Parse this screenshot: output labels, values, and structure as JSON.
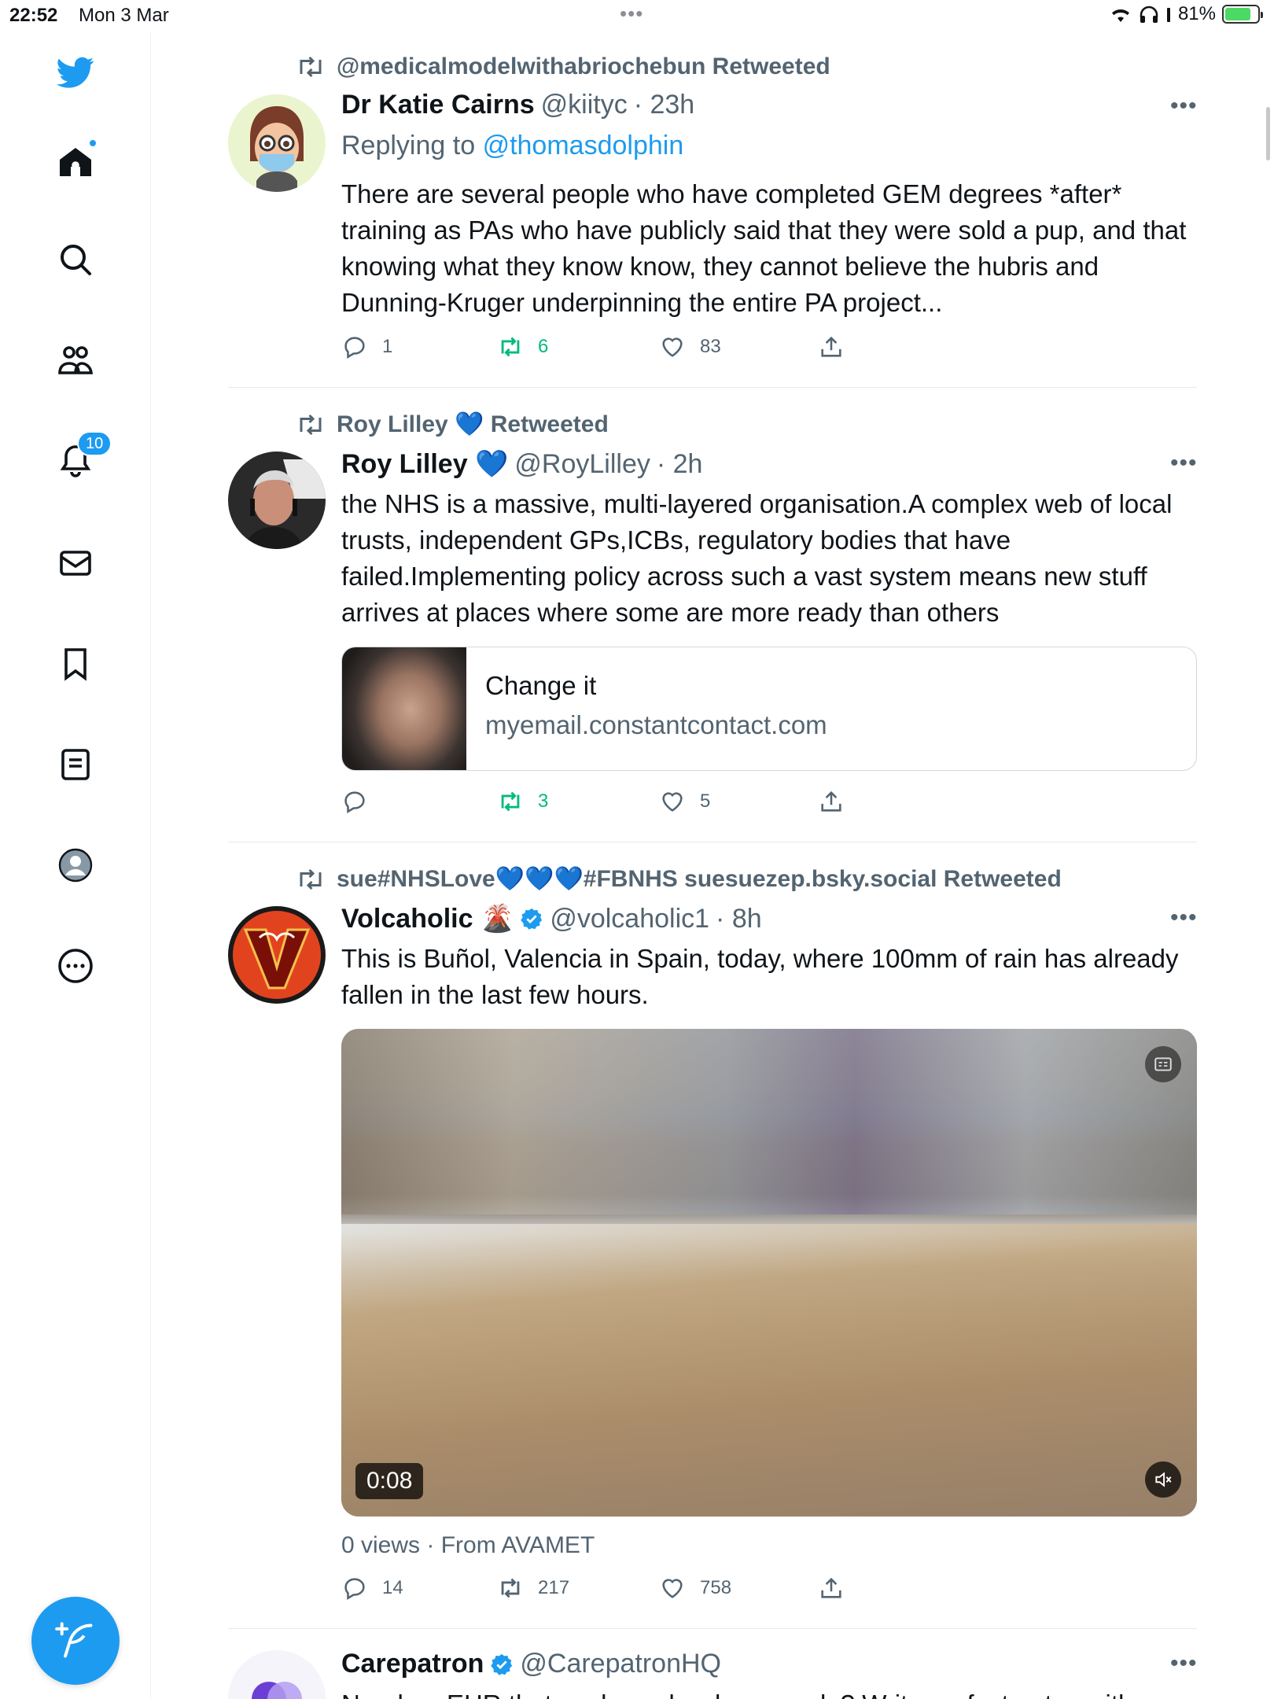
{
  "status_bar": {
    "time": "22:52",
    "date": "Mon 3 Mar",
    "battery": "81%",
    "battery_level": 0.81
  },
  "sidebar": {
    "notifications_badge": "10",
    "items": [
      "twitter-logo",
      "home-icon",
      "search-icon",
      "communities-icon",
      "notifications-icon",
      "messages-icon",
      "bookmarks-icon",
      "lists-icon",
      "profile-icon",
      "more-icon"
    ]
  },
  "tweets": [
    {
      "retweeted_by": "@medicalmodelwithabriochebun Retweeted",
      "name": "Dr Katie Cairns",
      "handle": "@kiityc",
      "time": "· 23h",
      "replying_label": "Replying to",
      "replying_to": "@thomasdolphin",
      "text": "There are several people who have completed GEM degrees *after* training as PAs who have publicly said that they were sold a pup, and that knowing what they know know, they cannot believe the hubris and Dunning-Kruger underpinning the entire PA project...",
      "replies": "1",
      "retweets": "6",
      "likes": "83"
    },
    {
      "retweeted_by": "Roy Lilley 💙 Retweeted",
      "name": "Roy Lilley 💙",
      "handle": "@RoyLilley",
      "time": "· 2h",
      "text": "the NHS is a massive, multi-layered organisation.A complex web of local trusts, independent GPs,ICBs, regulatory bodies that have failed.Implementing policy across such a vast system means new stuff arrives at places where some are more ready than others",
      "card": {
        "title": "Change it",
        "domain": "myemail.constantcontact.com"
      },
      "replies": "",
      "retweets": "3",
      "likes": "5"
    },
    {
      "retweeted_by": "sue#NHSLove💙💙💙#FBNHS suesuezep.bsky.social Retweeted",
      "name": "Volcaholic 🌋",
      "handle": "@volcaholic1",
      "time": "· 8h",
      "text": "This is Buñol, Valencia in Spain, today, where 100mm of rain has already fallen in the last few hours.",
      "video": {
        "duration": "0:08"
      },
      "views": "0 views · From AVAMET",
      "replies": "14",
      "retweets": "217",
      "likes": "758"
    },
    {
      "name": "Carepatron",
      "handle": "@CarepatronHQ",
      "text": "Need an EHR that works as hard as you do? Write perfect notes with"
    }
  ]
}
